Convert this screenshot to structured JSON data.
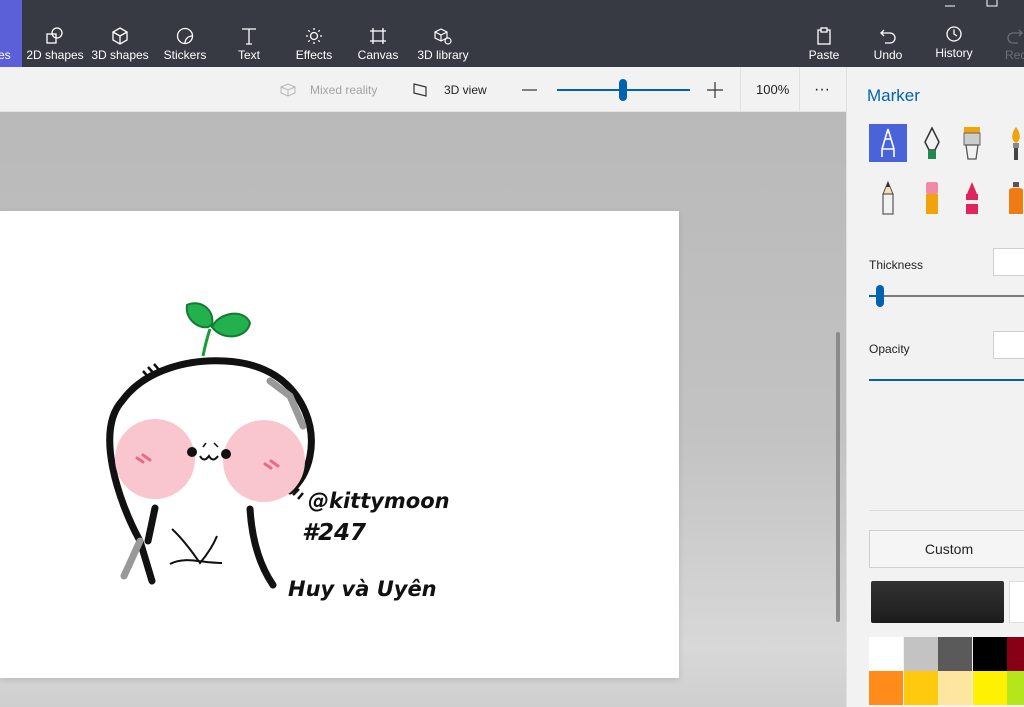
{
  "toolbar": {
    "items": [
      {
        "label": "es",
        "icon": "brushes-icon"
      },
      {
        "label": "2D shapes",
        "icon": "2d-shapes-icon"
      },
      {
        "label": "3D shapes",
        "icon": "3d-shapes-icon"
      },
      {
        "label": "Stickers",
        "icon": "stickers-icon"
      },
      {
        "label": "Text",
        "icon": "text-icon"
      },
      {
        "label": "Effects",
        "icon": "effects-icon"
      },
      {
        "label": "Canvas",
        "icon": "canvas-icon"
      },
      {
        "label": "3D library",
        "icon": "3d-library-icon"
      }
    ],
    "right": [
      {
        "label": "Paste",
        "icon": "paste-icon"
      },
      {
        "label": "Undo",
        "icon": "undo-icon"
      },
      {
        "label": "History",
        "icon": "history-icon"
      },
      {
        "label": "Red",
        "icon": "redo-icon"
      }
    ],
    "accent": "#5b5fd8"
  },
  "subbar": {
    "mixed_reality": "Mixed reality",
    "view_3d": "3D view",
    "zoom_percent": "100%",
    "zoom_level": 0.5
  },
  "canvas": {
    "signature_1": "@kittymoon",
    "signature_2": "#247",
    "signature_3": "Huy và Uyên"
  },
  "panel": {
    "title": "Marker",
    "thickness_label": "Thickness",
    "opacity_label": "Opacity",
    "custom_label": "Custom",
    "current_color": "#1c1c1c",
    "palette_row1": [
      "#ffffff",
      "#c3c3c3",
      "#5a5a5a",
      "#000000",
      "#880015"
    ],
    "palette_row2": [
      "#ff8c1a",
      "#ffc90e",
      "#ffe6a0",
      "#fff200",
      "#b5e61d"
    ]
  }
}
